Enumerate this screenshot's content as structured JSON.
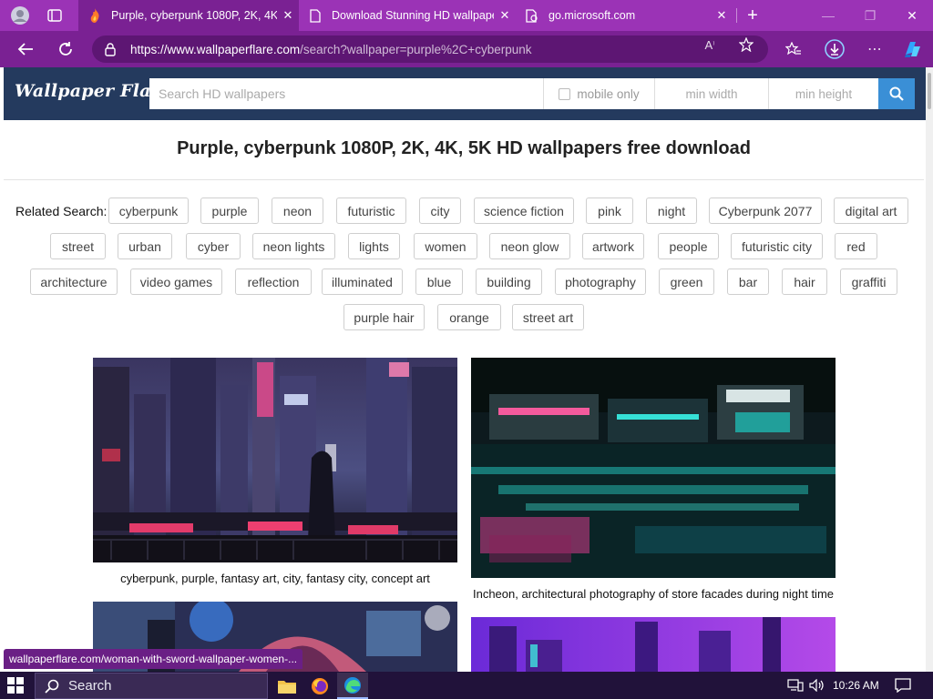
{
  "browser": {
    "tabs": [
      {
        "title": "Purple, cyberpunk 1080P, 2K, 4K,",
        "active": true
      },
      {
        "title": "Download Stunning HD wallpape",
        "active": false
      },
      {
        "title": "go.microsoft.com",
        "active": false
      }
    ],
    "new_tab_label": "+",
    "url_host": "https://www.wallpaperflare.com",
    "url_path": "/search?wallpaper=purple%2C+cyberpunk",
    "status_url": "wallpaperflare.com/woman-with-sword-wallpaper-women-...",
    "accent": "#9b33b6"
  },
  "site": {
    "logo": "Wallpaper Flare",
    "search_placeholder": "Search HD wallpapers",
    "mobile_only": "mobile only",
    "min_width": "min width",
    "min_height": "min height"
  },
  "page": {
    "title": "Purple, cyberpunk 1080P, 2K, 4K, 5K HD wallpapers free download",
    "related_label": "Related Search:",
    "tags": [
      [
        "cyberpunk",
        "purple",
        "neon",
        "futuristic",
        "city",
        "science fiction",
        "pink",
        "night",
        "Cyberpunk 2077",
        "digital art"
      ],
      [
        "street",
        "urban",
        "cyber",
        "neon lights",
        "lights",
        "women",
        "neon glow",
        "artwork",
        "people",
        "futuristic city",
        "red"
      ],
      [
        "architecture",
        "video games",
        "reflection",
        "illuminated",
        "blue",
        "building",
        "photography",
        "green",
        "bar",
        "hair",
        "graffiti"
      ],
      [
        "purple hair",
        "orange",
        "street art"
      ]
    ],
    "cards": [
      {
        "caption": "cyberpunk, purple, fantasy art, city, fantasy city, concept art"
      },
      {
        "caption": "Incheon, architectural photography of store facades during night time"
      }
    ]
  },
  "taskbar": {
    "search_label": "Search",
    "time": "10:26 AM"
  }
}
